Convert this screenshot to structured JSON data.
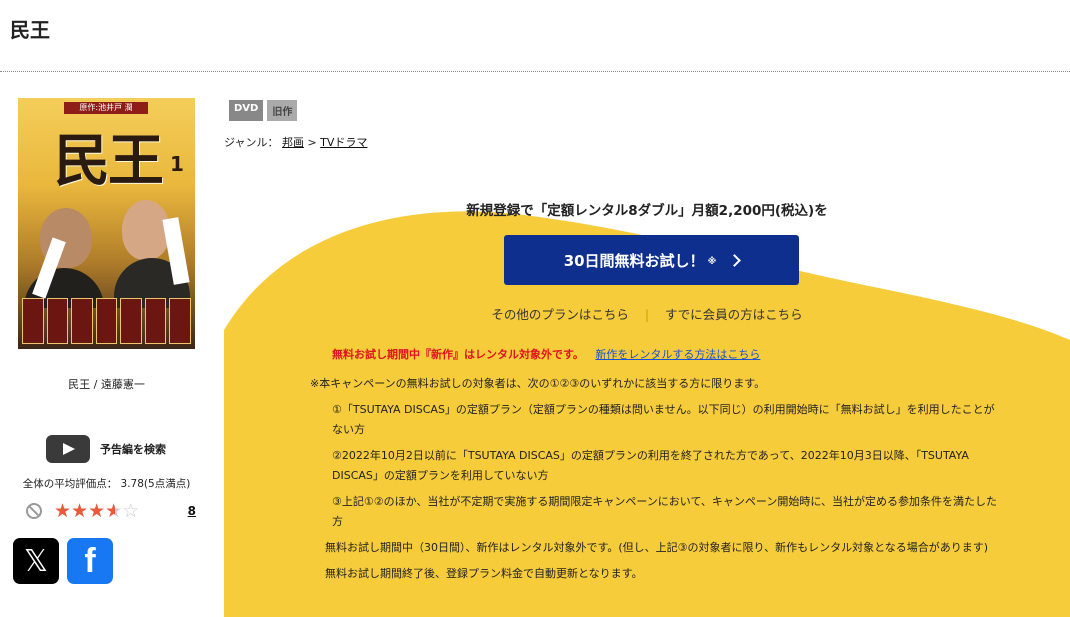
{
  "header": {
    "title": "民王"
  },
  "product": {
    "cover": {
      "crest_text": "原作:池井戸 潤",
      "title_text": "民王",
      "volume": "1"
    },
    "caption": "民王 / 遠藤憲一",
    "trailer_label": "予告編を検索",
    "average_rating_text": "全体の平均評価点： 3.78(5点満点)",
    "rating_value": 3.78,
    "rating_max": 5,
    "review_count": "8",
    "badges": [
      "DVD",
      "旧作"
    ],
    "genre_label": "ジャンル：",
    "genre_path": [
      "邦画",
      "TVドラマ"
    ],
    "genre_separator": ">"
  },
  "promo": {
    "headline": "新規登録で「定額レンタル8ダブル」月額2,200円(税込)を",
    "cta_label": "30日間無料お試し！",
    "cta_note": "※",
    "other_plans": "その他のプランはこちら",
    "separator": "|",
    "members_link": "すでに会員の方はこちら",
    "notice_red": "無料お試し期間中『新作』はレンタル対象外です。",
    "notice_link": "新作をレンタルする方法はこちら",
    "terms_intro": "※本キャンペーンの無料お試しの対象者は、次の①②③のいずれかに該当する方に限ります。",
    "conditions": [
      "①「TSUTAYA DISCAS」の定額プラン（定額プランの種類は問いません。以下同じ）の利用開始時に「無料お試し」を利用したことがない方",
      "②2022年10月2日以前に「TSUTAYA DISCAS」の定額プランの利用を終了された方であって、2022年10月3日以降、「TSUTAYA DISCAS」の定額プランを利用していない方",
      "③上記①②のほか、当社が不定期で実施する期間限定キャンペーンにおいて、キャンペーン開始時に、当社が定める参加条件を満たした方"
    ],
    "paragraphs": [
      "無料お試し期間中（30日間）、新作はレンタル対象外です。(但し、上記③の対象者に限り、新作もレンタル対象となる場合があります)",
      "無料お試し期間終了後、登録プラン料金で自動更新となります。"
    ],
    "colors": {
      "promo_bg": "#f7cc3a",
      "cta_bg": "#0f2f8e",
      "notice_red": "#e0141e",
      "link_blue": "#1a4fd6"
    }
  },
  "social": {
    "x_icon": "x-logo",
    "facebook_icon": "facebook-logo"
  }
}
